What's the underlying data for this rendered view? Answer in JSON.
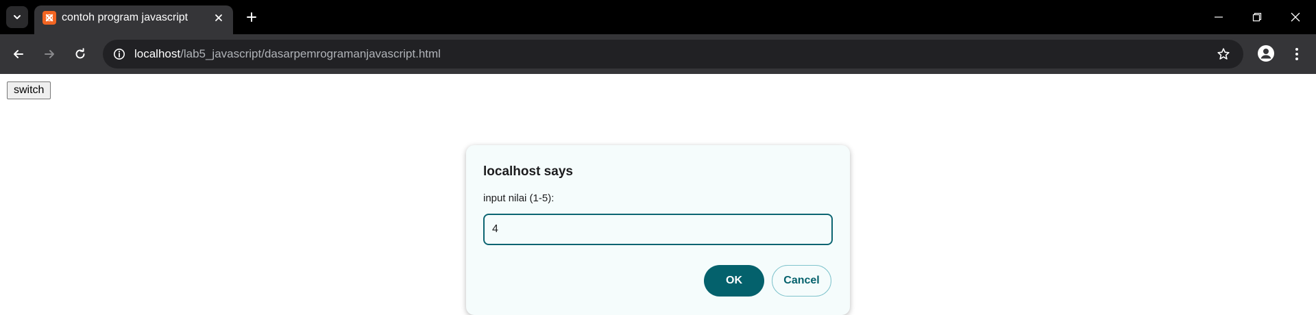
{
  "browser": {
    "tab": {
      "title": "contoh program javascript",
      "favicon": "xampp-icon"
    },
    "address_bar": {
      "host": "localhost",
      "path": "/lab5_javascript/dasarpemrogramanjavascript.html"
    },
    "colors": {
      "tabstrip": "#000000",
      "toolbar": "#353538",
      "omnibox": "#212124",
      "favicon": "#f26522"
    }
  },
  "page": {
    "switch_button_label": "switch"
  },
  "dialog": {
    "title": "localhost says",
    "message": "input nilai (1-5):",
    "input_value": "4",
    "ok_label": "OK",
    "cancel_label": "Cancel",
    "colors": {
      "background": "#f5fcfc",
      "accent": "#04616c"
    }
  }
}
